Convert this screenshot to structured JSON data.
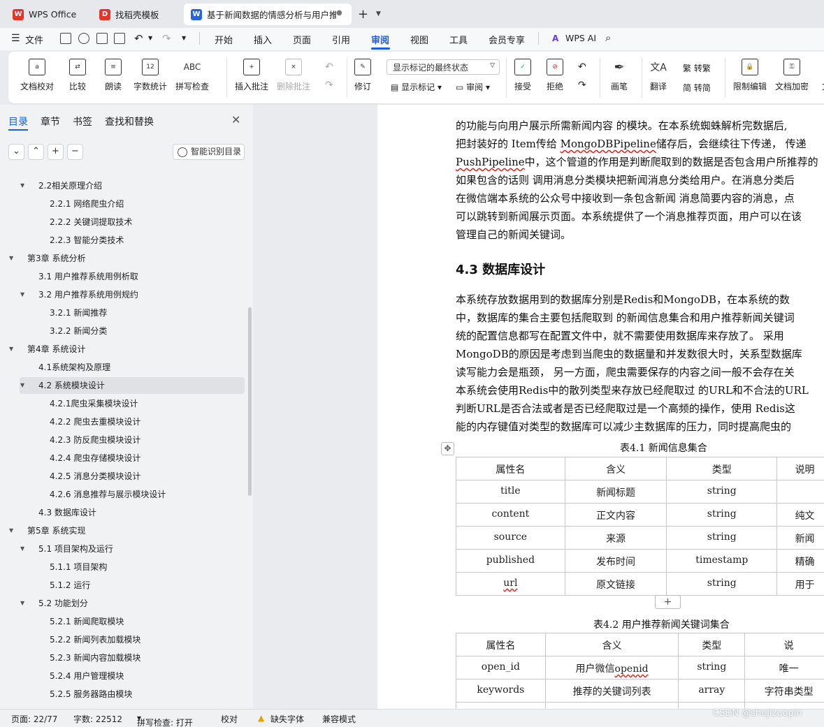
{
  "tabs": [
    {
      "label": "WPS Office",
      "icon": "wps-logo-icon",
      "color": "#e8332a"
    },
    {
      "label": "找稻壳模板",
      "icon": "docer-icon",
      "color": "#e8332a"
    },
    {
      "label": "基于新闻数据的情感分析与用户推",
      "icon": "word-doc-icon",
      "color": "#2b63d9"
    }
  ],
  "menu": {
    "file": "文件",
    "items": [
      "开始",
      "插入",
      "页面",
      "引用",
      "审阅",
      "视图",
      "工具",
      "会员专享"
    ],
    "active": "审阅",
    "ai": "WPS AI"
  },
  "ribbon": {
    "doc_check": "文档校对",
    "compare": "比较",
    "read": "朗读",
    "word_count": "字数统计",
    "spell_check": "拼写检查",
    "insert_comment": "插入批注",
    "delete_comment": "删除批注",
    "track": "修订",
    "markup_state": "显示标记的最终状态",
    "show_markup": "显示标记",
    "review": "审阅",
    "accept": "接受",
    "reject": "拒绝",
    "pen": "画笔",
    "translate": "翻译",
    "trad": "转繁",
    "simp": "转简",
    "restrict": "限制编辑",
    "encrypt": "文档加密",
    "cut_label": "文"
  },
  "sidebar": {
    "tabs": [
      "目录",
      "章节",
      "书签",
      "查找和替换"
    ],
    "active_tab": "目录",
    "ai_button": "智能识别目录",
    "toc": [
      {
        "text": "2.2相关原理介绍",
        "level": 2,
        "caret": "▼"
      },
      {
        "text": "2.2.1 网络爬虫介绍",
        "level": 3,
        "caret": ""
      },
      {
        "text": "2.2.2 关键词提取技术",
        "level": 3,
        "caret": ""
      },
      {
        "text": "2.2.3 智能分类技术",
        "level": 3,
        "caret": ""
      },
      {
        "text": "第3章 系统分析",
        "level": 1,
        "caret": "▼"
      },
      {
        "text": "3.1 用户推荐系统用例析取",
        "level": 2,
        "caret": ""
      },
      {
        "text": "3.2 用户推荐系统用例规约",
        "level": 2,
        "caret": "▼"
      },
      {
        "text": "3.2.1 新闻推荐",
        "level": 3,
        "caret": ""
      },
      {
        "text": "3.2.2 新闻分类",
        "level": 3,
        "caret": ""
      },
      {
        "text": "第4章 系统设计",
        "level": 1,
        "caret": "▼"
      },
      {
        "text": "4.1系统架构及原理",
        "level": 2,
        "caret": ""
      },
      {
        "text": "4.2 系统模块设计",
        "level": 2,
        "caret": "▼",
        "selected": true
      },
      {
        "text": "4.2.1爬虫采集模块设计",
        "level": 3,
        "caret": ""
      },
      {
        "text": "4.2.2 爬虫去重模块设计",
        "level": 3,
        "caret": ""
      },
      {
        "text": "4.2.3 防反爬虫模块设计",
        "level": 3,
        "caret": ""
      },
      {
        "text": "4.2.4 爬虫存储模块设计",
        "level": 3,
        "caret": ""
      },
      {
        "text": "4.2.5 消息分类模块设计",
        "level": 3,
        "caret": ""
      },
      {
        "text": "4.2.6 消息推荐与展示模块设计",
        "level": 3,
        "caret": ""
      },
      {
        "text": "4.3 数据库设计",
        "level": 2,
        "caret": ""
      },
      {
        "text": "第5章 系统实现",
        "level": 1,
        "caret": "▼"
      },
      {
        "text": "5.1 项目架构及运行",
        "level": 2,
        "caret": "▼"
      },
      {
        "text": "5.1.1 项目架构",
        "level": 3,
        "caret": ""
      },
      {
        "text": "5.1.2 运行",
        "level": 3,
        "caret": ""
      },
      {
        "text": "5.2 功能划分",
        "level": 2,
        "caret": "▼"
      },
      {
        "text": "5.2.1 新闻爬取模块",
        "level": 3,
        "caret": ""
      },
      {
        "text": "5.2.2 新闻列表加载模块",
        "level": 3,
        "caret": ""
      },
      {
        "text": "5.2.3 新闻内容加载模块",
        "level": 3,
        "caret": ""
      },
      {
        "text": "5.2.4 用户管理模块",
        "level": 3,
        "caret": ""
      },
      {
        "text": "5.2.5 服务器路由模块",
        "level": 3,
        "caret": ""
      }
    ]
  },
  "document": {
    "para1": [
      "的功能与向用户展示所需新闻内容 的模块。在本系统蜘蛛解析完数据后,",
      [
        "把封装好的 Item传给 ",
        "MongoDBPipeline",
        "储存后，会继续往下传递，  传递"
      ],
      [
        "",
        "PushPipeline",
        "中，这个管道的作用是判断爬取到的数据是否包含用户所推荐的"
      ],
      "如果包含的话则  调用消息分类模块把新闻消息分类给用户。在消息分类后",
      "在微信端本系统的公众号中接收到一条包含新闻 消息简要内容的消息，点",
      "可以跳转到新闻展示页面。本系统提供了一个消息推荐页面，用户可以在该",
      "管理自己的新闻关键词。"
    ],
    "heading": "4.3 数据库设计",
    "para2": [
      "    本系统存放数据用到的数据库分别是Redis和MongoDB，在本系统的数",
      "中，数据库的集合主要包括爬取到  的新闻信息集合和用户推荐新闻关键词",
      "统的配置信息都写在配置文件中，就不需要使用数据库来存放了。 采用",
      "MongoDB的原因是考虑到当爬虫的数据量和并发数很大时，关系型数据库",
      "读写能力会是瓶颈，  另一方面，爬虫需要保存的内容之间一般不会存在关",
      "本系统会使用Redis中的散列类型来存放已经爬取过  的URL和不合法的URL",
      "判断URL是否合法或者是否已经爬取过是一个高频的操作，使用 Redis这",
      "能的内存键值对类型的数据库可以减少主数据库的压力，同时提高爬虫的"
    ],
    "table1": {
      "caption": "表4.1 新闻信息集合",
      "header": [
        "属性名",
        "含义",
        "类型",
        "说明"
      ],
      "rows": [
        [
          "title",
          "新闻标题",
          "string",
          ""
        ],
        [
          "content",
          "正文内容",
          "string",
          "纯文"
        ],
        [
          "source",
          "来源",
          "string",
          "新闻"
        ],
        [
          "published",
          "发布时间",
          "timestamp",
          "精确"
        ],
        [
          "url",
          "原文链接",
          "string",
          "用于"
        ]
      ]
    },
    "table2": {
      "caption": "表4.2 用户推荐新闻关键词集合",
      "header": [
        "属性名",
        "含义",
        "类型",
        "说"
      ],
      "rows": [
        [
          "open_id",
          "用户微信openid",
          "string",
          "唯一"
        ],
        [
          "keywords",
          "推荐的关键词列表",
          "array",
          "字符串类型"
        ],
        [
          "tags",
          "推荐的标签列表",
          "array",
          "字符串类型"
        ]
      ]
    }
  },
  "status": {
    "page": "页面: 22/77",
    "words": "字数: 22512",
    "spell": "拼写检查: 打开",
    "proof": "校对",
    "missing_font": "缺失字体",
    "compat": "兼容模式"
  },
  "watermark": "CSDN @shejizuopin",
  "colors": {
    "accent": "#1b5fd6",
    "wps_red": "#e8332a",
    "warning": "#e8a000"
  }
}
